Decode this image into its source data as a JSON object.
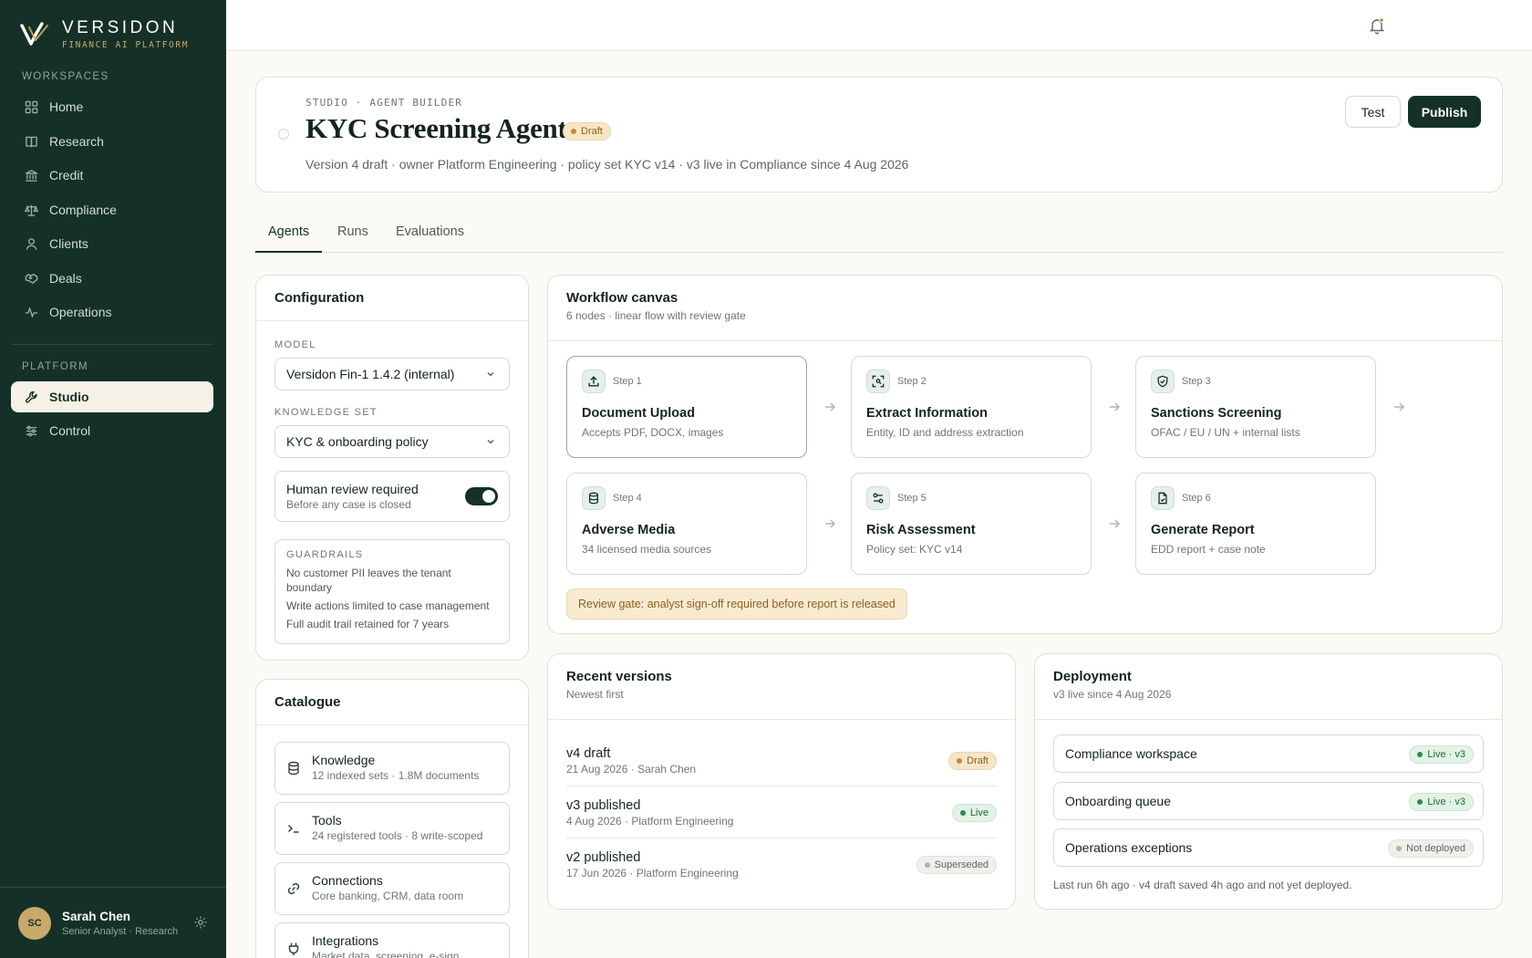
{
  "brand": {
    "name": "VERSIDON",
    "tagline": "FINANCE AI PLATFORM"
  },
  "sidebar": {
    "workspaces_label": "WORKSPACES",
    "workspaces": [
      {
        "label": "Home",
        "icon": "grid-icon"
      },
      {
        "label": "Research",
        "icon": "book-icon"
      },
      {
        "label": "Credit",
        "icon": "bank-icon"
      },
      {
        "label": "Compliance",
        "icon": "scale-icon"
      },
      {
        "label": "Clients",
        "icon": "user-icon"
      },
      {
        "label": "Deals",
        "icon": "handshake-icon"
      },
      {
        "label": "Operations",
        "icon": "activity-icon"
      }
    ],
    "platform_label": "PLATFORM",
    "platform": [
      {
        "label": "Studio",
        "icon": "wrench-icon",
        "active": true
      },
      {
        "label": "Control",
        "icon": "sliders-icon"
      }
    ],
    "user": {
      "initials": "SC",
      "name": "Sarah Chen",
      "role": "Senior Analyst · Research"
    }
  },
  "header": {
    "breadcrumb": "STUDIO · AGENT BUILDER",
    "title": "KYC Screening Agent",
    "status": "Draft",
    "meta": "Version 4 draft · owner Platform Engineering · policy set KYC v14 · v3 live in Compliance since 4 Aug 2026",
    "test_label": "Test",
    "publish_label": "Publish"
  },
  "tabs": [
    {
      "label": "Agents",
      "active": true
    },
    {
      "label": "Runs"
    },
    {
      "label": "Evaluations"
    }
  ],
  "configuration": {
    "title": "Configuration",
    "model_label": "MODEL",
    "model_value": "Versidon Fin-1 1.4.2 (internal)",
    "knowledge_label": "KNOWLEDGE SET",
    "knowledge_value": "KYC & onboarding policy",
    "review_title": "Human review required",
    "review_sub": "Before any case is closed",
    "review_enabled": true,
    "guardrails_label": "GUARDRAILS",
    "guardrails": [
      "No customer PII leaves the tenant boundary",
      "Write actions limited to case management",
      "Full audit trail retained for 7 years"
    ]
  },
  "catalogue": {
    "title": "Catalogue",
    "items": [
      {
        "title": "Knowledge",
        "sub": "12 indexed sets · 1.8M documents",
        "icon": "database-icon"
      },
      {
        "title": "Tools",
        "sub": "24 registered tools · 8 write-scoped",
        "icon": "terminal-icon"
      },
      {
        "title": "Connections",
        "sub": "Core banking, CRM, data room",
        "icon": "link-icon"
      },
      {
        "title": "Integrations",
        "sub": "Market data, screening, e-sign",
        "icon": "plug-icon"
      }
    ]
  },
  "workflow": {
    "title": "Workflow canvas",
    "subtitle": "6 nodes · linear flow with review gate",
    "nodes": [
      {
        "step": "Step 1",
        "title": "Document Upload",
        "sub": "Accepts PDF, DOCX, images",
        "icon": "upload-icon"
      },
      {
        "step": "Step 2",
        "title": "Extract Information",
        "sub": "Entity, ID and address extraction",
        "icon": "scan-icon"
      },
      {
        "step": "Step 3",
        "title": "Sanctions Screening",
        "sub": "OFAC / EU / UN + internal lists",
        "icon": "shield-icon"
      },
      {
        "step": "Step 4",
        "title": "Adverse Media",
        "sub": "34 licensed media sources",
        "icon": "database-icon"
      },
      {
        "step": "Step 5",
        "title": "Risk Assessment",
        "sub": "Policy set: KYC v14",
        "icon": "filter-icon"
      },
      {
        "step": "Step 6",
        "title": "Generate Report",
        "sub": "EDD report + case note",
        "icon": "document-icon"
      }
    ],
    "review_gate": "Review gate: analyst sign-off required before report is released"
  },
  "versions": {
    "title": "Recent versions",
    "subtitle": "Newest first",
    "rows": [
      {
        "title": "v4 draft",
        "sub": "21 Aug 2026 · Sarah Chen",
        "badge": "Draft",
        "kind": "draft"
      },
      {
        "title": "v3 published",
        "sub": "4 Aug 2026 · Platform Engineering",
        "badge": "Live",
        "kind": "live"
      },
      {
        "title": "v2 published",
        "sub": "17 Jun 2026 · Platform Engineering",
        "badge": "Superseded",
        "kind": "muted"
      }
    ]
  },
  "deployment": {
    "title": "Deployment",
    "subtitle": "v3 live since 4 Aug 2026",
    "rows": [
      {
        "name": "Compliance workspace",
        "badge": "Live · v3",
        "kind": "live"
      },
      {
        "name": "Onboarding queue",
        "badge": "Live · v3",
        "kind": "live"
      },
      {
        "name": "Operations exceptions",
        "badge": "Not deployed",
        "kind": "muted"
      }
    ],
    "footer": "Last run 6h ago · v4 draft saved 4h ago and not yet deployed."
  },
  "colors": {
    "sidebar": "#153127",
    "accent": "#c9a96a",
    "primary_button": "#153127",
    "live": "#2d8a4e",
    "draft": "#c98a2b"
  }
}
